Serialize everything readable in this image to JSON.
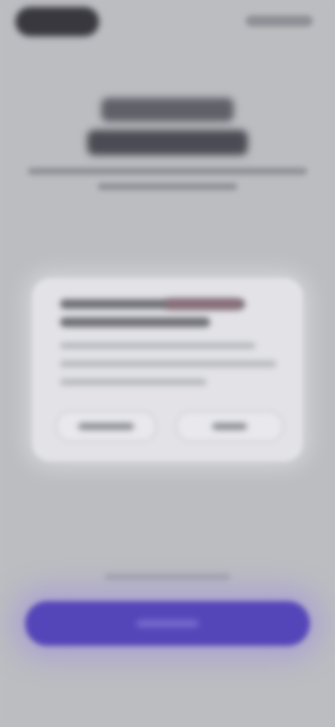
{
  "screen": {
    "note_colors": {
      "background": "#bcbdc1",
      "card": "#e3e3e7",
      "primary": "#5446b8"
    }
  },
  "header": {
    "icons": [
      "status-pill",
      "status-indicators"
    ]
  },
  "content": {
    "heading_lines": 2,
    "subtitle_lines": 2
  },
  "card": {
    "title_lines": 2,
    "body_lines": 3,
    "buttons": 2
  },
  "footer": {
    "hint_lines": 1,
    "primary_button": true
  }
}
